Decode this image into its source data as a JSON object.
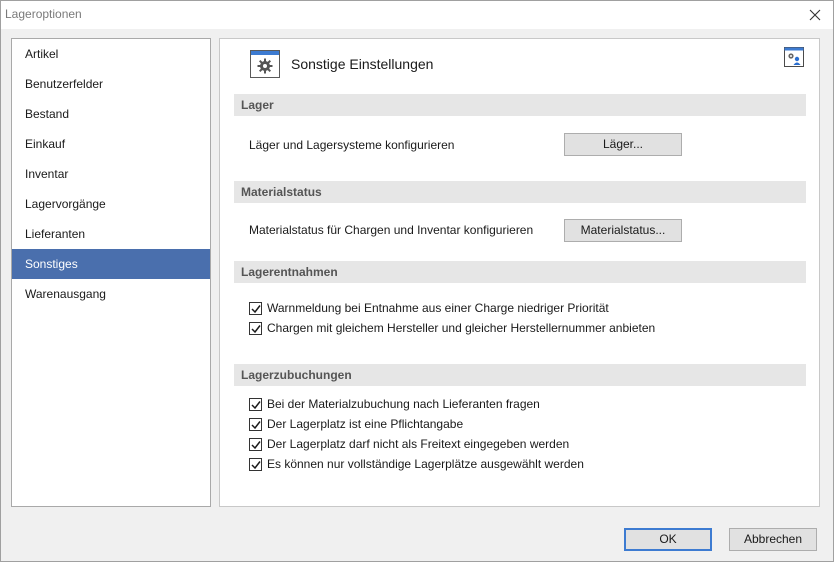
{
  "window": {
    "title": "Lageroptionen"
  },
  "nav": {
    "items": [
      {
        "label": "Artikel"
      },
      {
        "label": "Benutzerfelder"
      },
      {
        "label": "Bestand"
      },
      {
        "label": "Einkauf"
      },
      {
        "label": "Inventar"
      },
      {
        "label": "Lagervorgänge"
      },
      {
        "label": "Lieferanten"
      },
      {
        "label": "Sonstiges",
        "selected": true
      },
      {
        "label": "Warenausgang"
      }
    ]
  },
  "panel": {
    "title": "Sonstige Einstellungen",
    "header_icon": "gear-icon",
    "corner_icon": "user-settings-icon",
    "sections": {
      "lager": {
        "heading": "Lager",
        "row_label": "Läger und Lagersysteme konfigurieren",
        "button_label": "Läger..."
      },
      "materialstatus": {
        "heading": "Materialstatus",
        "row_label": "Materialstatus für Chargen und Inventar konfigurieren",
        "button_label": "Materialstatus..."
      },
      "lagerentnahmen": {
        "heading": "Lagerentnahmen",
        "options": [
          {
            "label": "Warnmeldung bei Entnahme aus einer Charge niedriger Priorität",
            "checked": true
          },
          {
            "label": "Chargen mit gleichem Hersteller und gleicher Herstellernummer anbieten",
            "checked": true
          }
        ]
      },
      "lagerzubuchungen": {
        "heading": "Lagerzubuchungen",
        "options": [
          {
            "label": "Bei der Materialzubuchung nach Lieferanten fragen",
            "checked": true
          },
          {
            "label": "Der Lagerplatz ist eine Pflichtangabe",
            "checked": true
          },
          {
            "label": "Der Lagerplatz darf nicht als Freitext eingegeben werden",
            "checked": true
          },
          {
            "label": "Es können nur vollständige Lagerplätze ausgewählt werden",
            "checked": true
          }
        ]
      }
    }
  },
  "footer": {
    "ok_label": "OK",
    "cancel_label": "Abbrechen"
  },
  "colors": {
    "accent": "#4a6fad",
    "default_button_border": "#3d7bd1",
    "section_bg": "#e6e6e6"
  }
}
